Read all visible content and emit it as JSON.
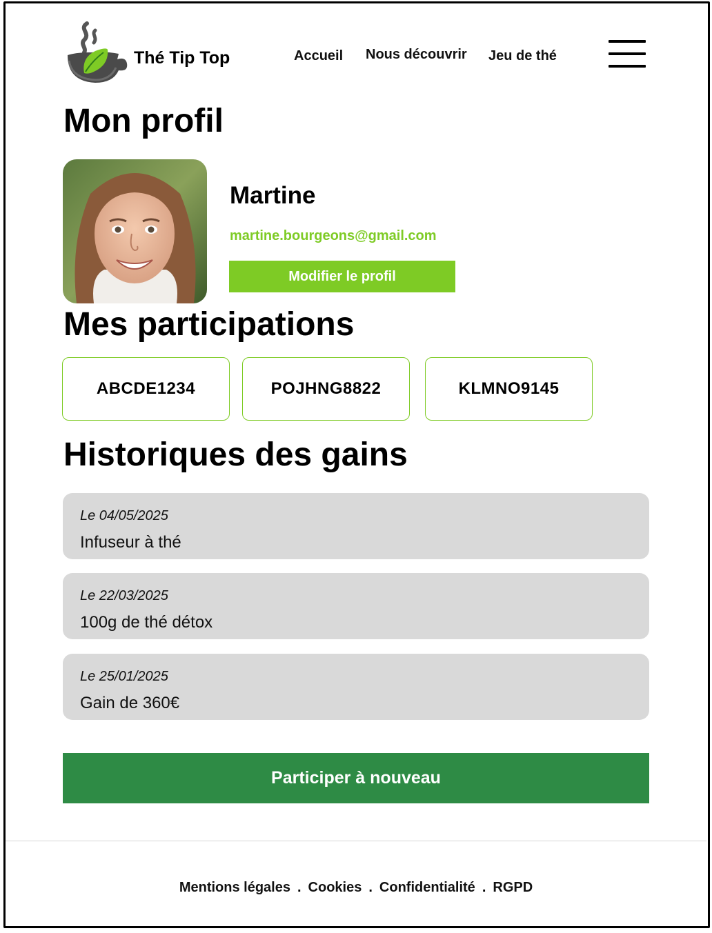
{
  "header": {
    "brand": "Thé Tip Top",
    "logo_icon": "tea-cup-logo-icon",
    "nav": [
      {
        "label": "Accueil"
      },
      {
        "label": "Nous découvrir"
      },
      {
        "label": "Jeu de thé"
      }
    ],
    "menu_icon": "hamburger-menu-icon"
  },
  "profile": {
    "title": "Mon profil",
    "name": "Martine",
    "email": "martine.bourgeons@gmail.com",
    "edit_label": "Modifier le profil"
  },
  "participations": {
    "title": "Mes participations",
    "codes": [
      "ABCDE1234",
      "POJHNG8822",
      "KLMNO9145"
    ]
  },
  "history": {
    "title": "Historiques des gains",
    "items": [
      {
        "date": "Le 04/05/2025",
        "label": "Infuseur à thé"
      },
      {
        "date": "Le 22/03/2025",
        "label": "100g de thé détox"
      },
      {
        "date": "Le 25/01/2025",
        "label": "Gain de 360€"
      }
    ]
  },
  "cta": {
    "label": "Participer à nouveau"
  },
  "footer": {
    "links": [
      "Mentions légales",
      "Cookies",
      "Confidentialité",
      "RGPD"
    ],
    "separator": "."
  },
  "colors": {
    "accent": "#7ecb25",
    "primary_button": "#2e8b45",
    "card_bg": "#d9d9d9"
  }
}
